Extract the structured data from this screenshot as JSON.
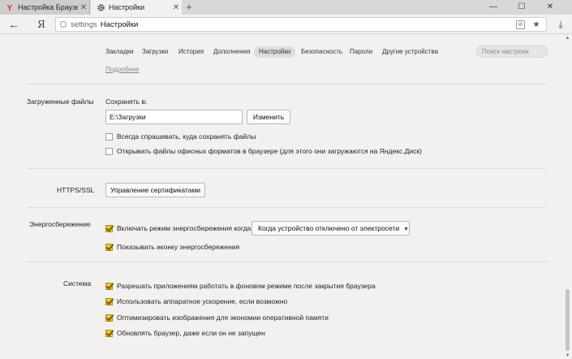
{
  "tabs": [
    {
      "title": "Настройка Браузера",
      "icon": "yandex-icon"
    },
    {
      "title": "Настройки",
      "icon": "gear-icon"
    }
  ],
  "window": {
    "minimize": "—",
    "maximize": "☐",
    "close": "✕",
    "new_tab": "+"
  },
  "address": {
    "host": "settings",
    "title": "Настройки"
  },
  "settings_nav": {
    "items": [
      "Закладки",
      "Загрузки",
      "История",
      "Дополнения",
      "Настройки",
      "Безопасность",
      "Пароли",
      "Другие устройства"
    ],
    "active": "Настройки",
    "search_placeholder": "Поиск настроек"
  },
  "more_link": "Подробнее",
  "downloads": {
    "section_label": "Загруженные файлы",
    "save_to_label": "Сохранять в:",
    "path": "E:\\Загрузки",
    "change_button": "Изменить",
    "ask_where": {
      "label": "Всегда спрашивать, куда сохранять файлы",
      "checked": false
    },
    "open_office": {
      "label": "Открывать файлы офисных форматов в браузере (для этого они загружаются на Яндекс.Диск)",
      "checked": false
    }
  },
  "https": {
    "section_label": "HTTPS/SSL",
    "manage_button": "Управление сертификатами"
  },
  "power": {
    "section_label": "Энергосбережение",
    "enable": {
      "label": "Включать режим энергосбережения когда",
      "checked": true
    },
    "mode_select": "Когда устройство отключено от электросети",
    "show_icon": {
      "label": "Показывать иконку энергосбережения",
      "checked": true
    }
  },
  "system": {
    "section_label": "Система",
    "options": [
      {
        "label": "Разрешать приложениям работать в фоновом режиме после закрытия браузера",
        "checked": true
      },
      {
        "label": "Использовать аппаратное ускорение, если возможно",
        "checked": true
      },
      {
        "label": "Оптимизировать изображения для экономии оперативной памяти",
        "checked": true
      },
      {
        "label": "Обновлять браузер, даже если он не запущен",
        "checked": true
      }
    ]
  },
  "colors": {
    "checkbox_checked": "#e9c63d",
    "page_bg": "#f2f1f0",
    "tabstrip_bg": "#d9d8d6"
  }
}
